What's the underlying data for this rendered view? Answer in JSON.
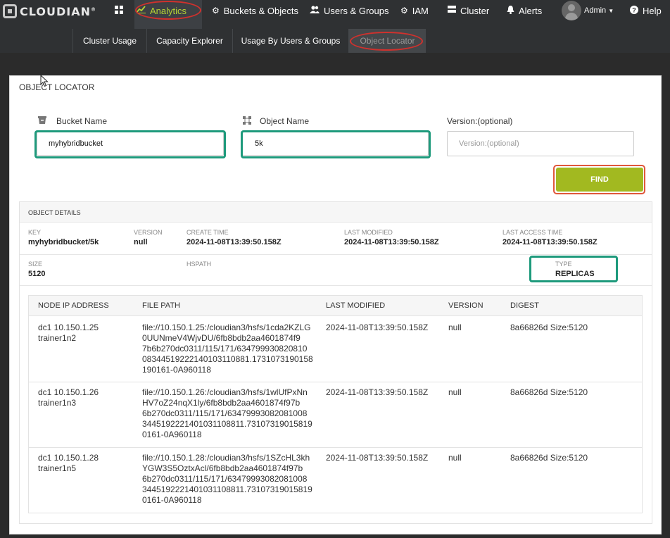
{
  "brand": {
    "name": "CLOUDIAN",
    "mark": "®"
  },
  "nav": {
    "dashboard_icon": "grid-icon",
    "items": [
      {
        "label": "Analytics",
        "icon": "chart-icon"
      },
      {
        "label": "Buckets & Objects",
        "icon": "gear-icon"
      },
      {
        "label": "Users & Groups",
        "icon": "users-icon"
      },
      {
        "label": "IAM",
        "icon": "gear-icon"
      },
      {
        "label": "Cluster",
        "icon": "server-icon"
      },
      {
        "label": "Alerts",
        "icon": "bell-icon"
      },
      {
        "label": "Admin",
        "icon": "avatar"
      },
      {
        "label": "Help",
        "icon": "question-icon"
      }
    ],
    "active_color": "#b5d334"
  },
  "subnav": {
    "items": [
      "Cluster Usage",
      "Capacity Explorer",
      "Usage By Users & Groups",
      "Object Locator"
    ],
    "active": "Object Locator"
  },
  "page": {
    "title": "OBJECT LOCATOR",
    "bucket": {
      "label": "Bucket Name",
      "value": "myhybridbucket"
    },
    "object": {
      "label": "Object Name",
      "value": "5k"
    },
    "version": {
      "label": "Version:(optional)",
      "placeholder": "Version:(optional)"
    },
    "find_label": "FIND"
  },
  "details": {
    "header": "OBJECT DETAILS",
    "key": {
      "label": "KEY",
      "value": "myhybridbucket/5k"
    },
    "version": {
      "label": "VERSION",
      "value": "null"
    },
    "create_time": {
      "label": "CREATE TIME",
      "value": "2024-11-08T13:39:50.158Z"
    },
    "last_modified": {
      "label": "LAST MODIFIED",
      "value": "2024-11-08T13:39:50.158Z"
    },
    "last_access": {
      "label": "LAST ACCESS TIME",
      "value": "2024-11-08T13:39:50.158Z"
    },
    "size": {
      "label": "SIZE",
      "value": "5120"
    },
    "hspath": {
      "label": "HSPATH",
      "value": ""
    },
    "type": {
      "label": "TYPE",
      "value": "REPLICAS"
    }
  },
  "table": {
    "headers": [
      "NODE IP ADDRESS",
      "FILE PATH",
      "LAST MODIFIED",
      "VERSION",
      "DIGEST"
    ],
    "rows": [
      {
        "ip": "dc1 10.150.1.25",
        "host": "trainer1n2",
        "path": [
          "file://10.150.1.25:/cloudian3/hsfs/1cda2KZLG",
          "0UUNmeV4WjvDU/6fb8bdb2aa4601874f9",
          "7b6b270dc0311/115/171/634799930820810",
          "08344519222140103110881.1731073190158",
          "190161-0A960118"
        ],
        "modified": "2024-11-08T13:39:50.158Z",
        "version": "null",
        "digest": "8a66826d Size:5120"
      },
      {
        "ip": "dc1 10.150.1.26",
        "host": "trainer1n3",
        "path": [
          "file://10.150.1.26:/cloudian3/hsfs/1wlUfPxNn",
          "HV7oZ24nqX1ly/6fb8bdb2aa4601874f97b",
          "6b270dc0311/115/171/63479993082081008",
          "3445192221401031108811.73107319015819",
          "0161-0A960118"
        ],
        "modified": "2024-11-08T13:39:50.158Z",
        "version": "null",
        "digest": "8a66826d Size:5120"
      },
      {
        "ip": "dc1 10.150.1.28",
        "host": "trainer1n5",
        "path": [
          "file://10.150.1.28:/cloudian3/hsfs/1SZcHL3kh",
          "YGW3S5OztxAcl/6fb8bdb2aa4601874f97b",
          "6b270dc0311/115/171/63479993082081008",
          "3445192221401031108811.73107319015819",
          "0161-0A960118"
        ],
        "modified": "2024-11-08T13:39:50.158Z",
        "version": "null",
        "digest": "8a66826d Size:5120"
      }
    ]
  }
}
